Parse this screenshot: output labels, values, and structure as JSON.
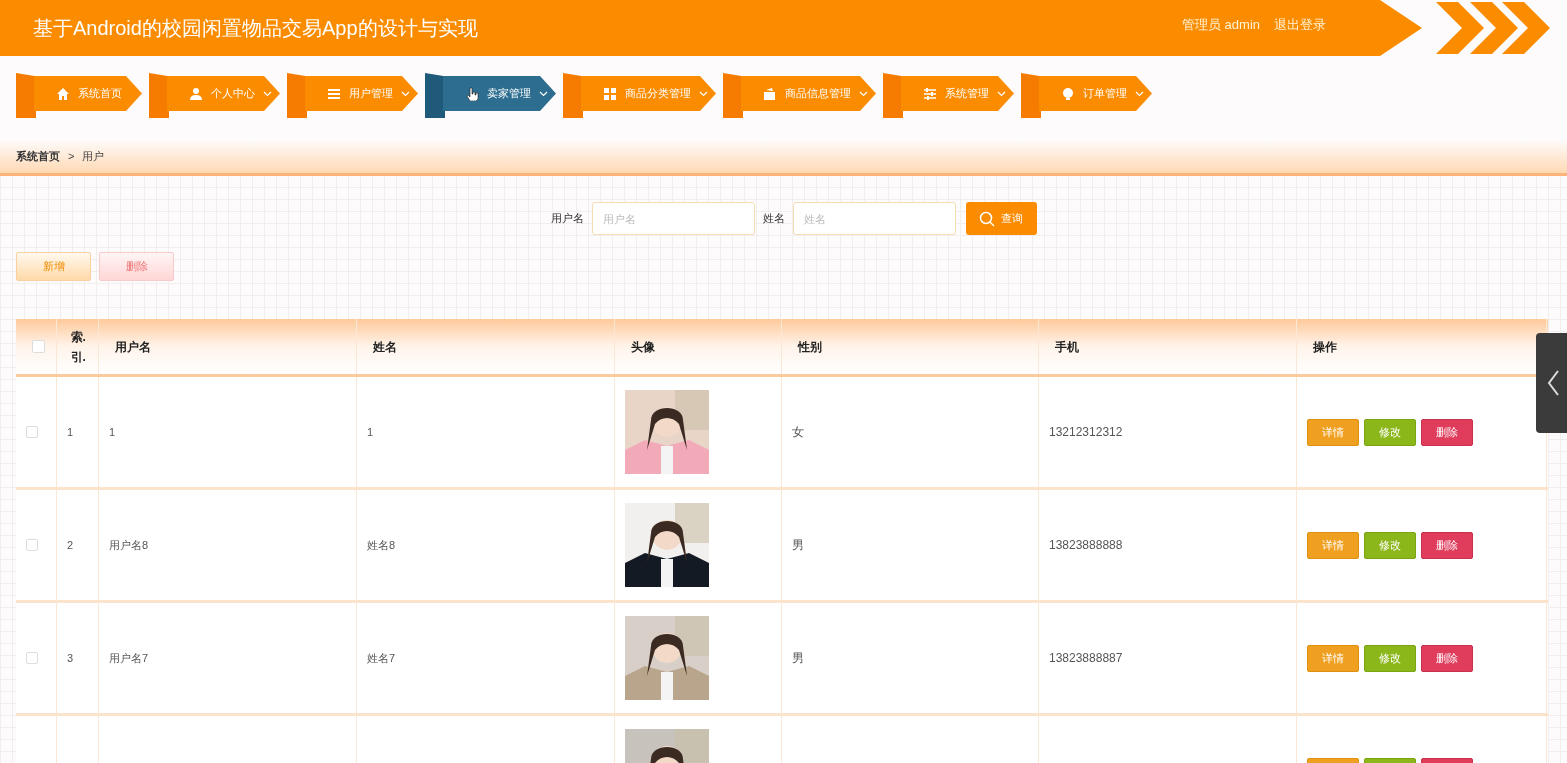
{
  "header": {
    "title": "基于Android的校园闲置物品交易App的设计与实现",
    "user": "管理员 admin",
    "logout": "退出登录"
  },
  "nav": [
    {
      "label": "系统首页",
      "selected": false,
      "dropdown": false
    },
    {
      "label": "个人中心",
      "selected": false,
      "dropdown": true
    },
    {
      "label": "用户管理",
      "selected": false,
      "dropdown": true
    },
    {
      "label": "卖家管理",
      "selected": true,
      "dropdown": true
    },
    {
      "label": "商品分类管理",
      "selected": false,
      "dropdown": true
    },
    {
      "label": "商品信息管理",
      "selected": false,
      "dropdown": true
    },
    {
      "label": "系统管理",
      "selected": false,
      "dropdown": true
    },
    {
      "label": "订单管理",
      "selected": false,
      "dropdown": true
    }
  ],
  "breadcrumb": [
    "系统首页",
    ">",
    "用户"
  ],
  "search": {
    "fields": [
      {
        "label": "用户名",
        "placeholder": "用户名"
      },
      {
        "label": "姓名",
        "placeholder": "姓名"
      }
    ],
    "button": "查询"
  },
  "toolbar": [
    {
      "label": "新增",
      "kind": "add"
    },
    {
      "label": "删除",
      "kind": "delete"
    }
  ],
  "table": {
    "select_all_checked": false,
    "columns": [
      "索.引.",
      "用户名",
      "姓名",
      "头像",
      "性别",
      "手机",
      "操作"
    ],
    "rows": [
      {
        "checked": false,
        "index": "1",
        "username": "1",
        "name": "1",
        "avatar": {
          "kind": "picture"
        },
        "gender": "女",
        "phone": "13212312312",
        "actions": [
          {
            "label": "详情",
            "kind": "detail"
          },
          {
            "label": "修改",
            "kind": "edit"
          },
          {
            "label": "删除",
            "kind": "delete"
          }
        ]
      },
      {
        "checked": false,
        "index": "2",
        "username": "用户名8",
        "name": "姓名8",
        "avatar": {
          "kind": "picture"
        },
        "gender": "男",
        "phone": "13823888888",
        "actions": [
          {
            "label": "详情",
            "kind": "detail"
          },
          {
            "label": "修改",
            "kind": "edit"
          },
          {
            "label": "删除",
            "kind": "delete"
          }
        ]
      },
      {
        "checked": false,
        "index": "3",
        "username": "用户名7",
        "name": "姓名7",
        "avatar": {
          "kind": "picture"
        },
        "gender": "男",
        "phone": "13823888887",
        "actions": [
          {
            "label": "详情",
            "kind": "detail"
          },
          {
            "label": "修改",
            "kind": "edit"
          },
          {
            "label": "删除",
            "kind": "delete"
          }
        ]
      },
      {
        "avatar": {
          "kind": "picture"
        },
        "actions": [
          {
            "kind": "detail"
          },
          {
            "kind": "edit"
          },
          {
            "kind": "delete"
          }
        ]
      }
    ]
  }
}
